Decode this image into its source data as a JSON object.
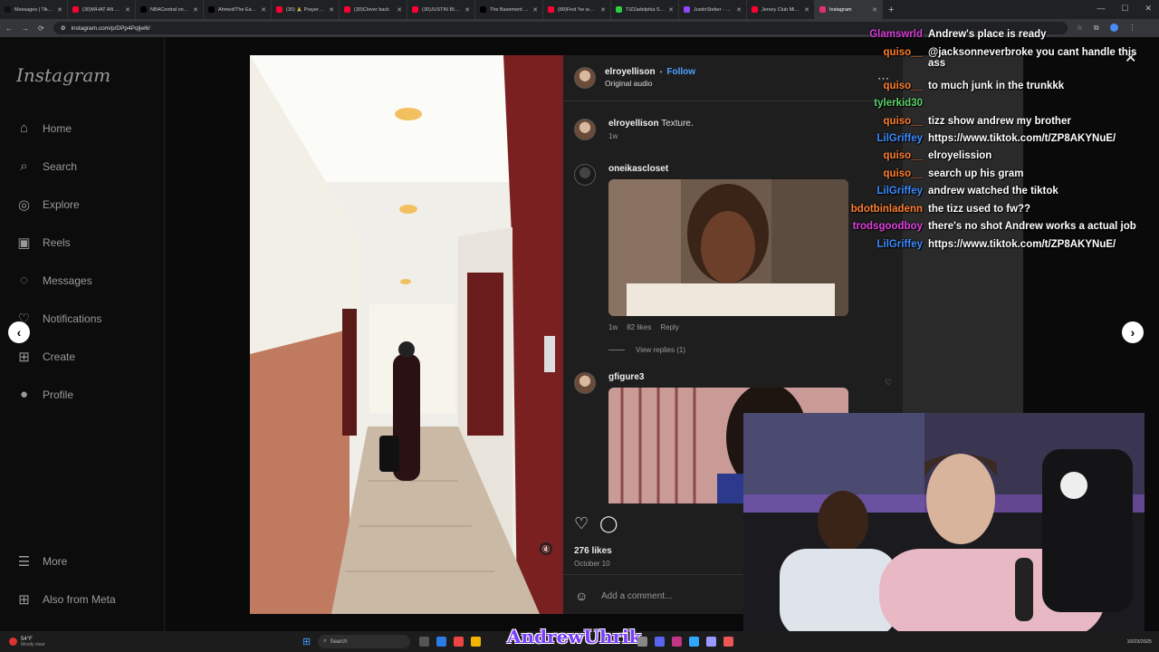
{
  "browser": {
    "tabs": [
      {
        "title": "Messages | TikTok",
        "color": "#111"
      },
      {
        "title": "(30)WHAT AN NBA",
        "color": "#ff0033"
      },
      {
        "title": "NBACentral on X: \"/",
        "color": "#000"
      },
      {
        "title": "Ahmed/The Ears/&",
        "color": "#000"
      },
      {
        "title": "(30) 🙏 Prayers up",
        "color": "#ff0033"
      },
      {
        "title": "(30)Clover back",
        "color": "#ff0033"
      },
      {
        "title": "(30)JUSTIN BIEBER",
        "color": "#ff0033"
      },
      {
        "title": "The Basement Spor",
        "color": "#000"
      },
      {
        "title": "(89)Find 'he was m",
        "color": "#ff0033"
      },
      {
        "title": "TIZZadelphia Stream",
        "color": "#2ecc40"
      },
      {
        "title": "JustinSteber - Twitch",
        "color": "#9146ff"
      },
      {
        "title": "Jersey Club Mix 2 (",
        "color": "#ff0033"
      },
      {
        "title": "Instagram",
        "color": "#e1306c"
      }
    ],
    "url": "instagram.com/p/DPp4Pqljel6/"
  },
  "sidebar": {
    "logo": "Instagram",
    "items": [
      {
        "label": "Home",
        "icon": "⌂",
        "icon_name": "home-icon"
      },
      {
        "label": "Search",
        "icon": "⌕",
        "icon_name": "search-icon"
      },
      {
        "label": "Explore",
        "icon": "◎",
        "icon_name": "compass-icon"
      },
      {
        "label": "Reels",
        "icon": "▣",
        "icon_name": "reels-icon"
      },
      {
        "label": "Messages",
        "icon": "◌",
        "icon_name": "messenger-icon"
      },
      {
        "label": "Notifications",
        "icon": "♡",
        "icon_name": "heart-icon"
      },
      {
        "label": "Create",
        "icon": "⊞",
        "icon_name": "plus-icon"
      },
      {
        "label": "Profile",
        "icon": "●",
        "icon_name": "avatar-icon"
      }
    ],
    "more": "More",
    "meta": "Also from Meta"
  },
  "post": {
    "author": "elroyellison",
    "follow": "Follow",
    "audio": "Original audio",
    "caption_user": "elroyellison",
    "caption_text": "Texture.",
    "caption_time": "1w",
    "comments": [
      {
        "user": "oneikascloset",
        "time": "1w",
        "likes": "82 likes",
        "reply": "Reply",
        "view_replies": "View replies (1)"
      },
      {
        "user": "gfigure3"
      }
    ],
    "likes": "276 likes",
    "date": "October 10",
    "add_comment": "Add a comment..."
  },
  "chat": [
    {
      "name": "Glamswrld",
      "color": "#d63ed8",
      "msg": "Andrew's place is ready"
    },
    {
      "name": "quiso__",
      "color": "#ff7f32",
      "msg": "@jacksonneverbroke you cant handle this ass"
    },
    {
      "name": "quiso__",
      "color": "#ff7f32",
      "msg": "to much junk in the trunkkk"
    },
    {
      "name": "tylerkid30",
      "color": "#5bd46a",
      "msg": ""
    },
    {
      "name": "quiso__",
      "color": "#ff7f32",
      "msg": "tizz show andrew my brother"
    },
    {
      "name": "LilGriffey",
      "color": "#3d8bff",
      "msg": "https://www.tiktok.com/t/ZP8AKYNuE/"
    },
    {
      "name": "quiso__",
      "color": "#ff7f32",
      "msg": "elroyelission"
    },
    {
      "name": "quiso__",
      "color": "#ff7f32",
      "msg": "search up his gram"
    },
    {
      "name": "LilGriffey",
      "color": "#3d8bff",
      "msg": "andrew watched the tiktok"
    },
    {
      "name": "bdotbinladenn",
      "color": "#ff7f32",
      "msg": "the tizz used to fw??"
    },
    {
      "name": "trodsgoodboy",
      "color": "#e040e0",
      "msg": "there's no shot Andrew works a actual job"
    },
    {
      "name": "LilGriffey",
      "color": "#3d8bff",
      "msg": "https://www.tiktok.com/t/ZP8AKYNuE/"
    }
  ],
  "taskbar": {
    "weather_temp": "54°F",
    "weather_desc": "Mostly clear",
    "search": "Search",
    "overlay_name": "AndrewUhrik",
    "date": "10/23/2025"
  }
}
